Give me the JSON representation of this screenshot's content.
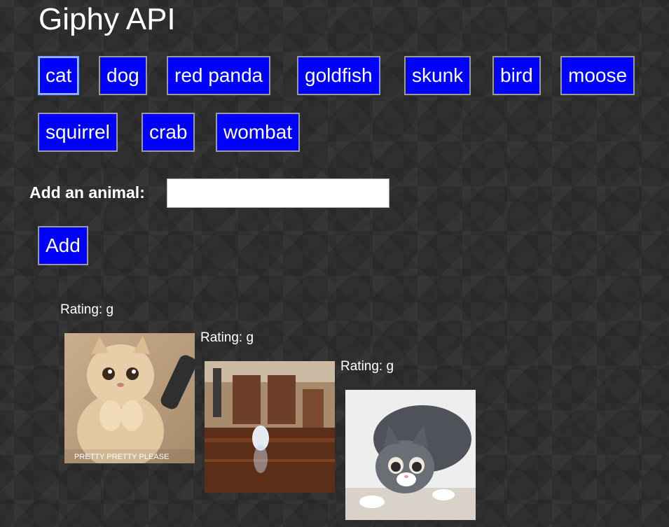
{
  "title": "Giphy API",
  "buttons": [
    "cat",
    "dog",
    "red panda",
    "goldfish",
    "skunk",
    "bird",
    "moose",
    "squirrel",
    "crab",
    "wombat"
  ],
  "form": {
    "label": "Add an animal:",
    "input_value": "",
    "add_label": "Add"
  },
  "results": [
    {
      "rating": "Rating: g",
      "caption": "PRETTY PRETTY PLEASE"
    },
    {
      "rating": "Rating: g"
    },
    {
      "rating": "Rating: g"
    }
  ],
  "colors": {
    "button_bg": "#0000ff",
    "button_text": "#ffffff",
    "background": "#2f2f2f"
  }
}
